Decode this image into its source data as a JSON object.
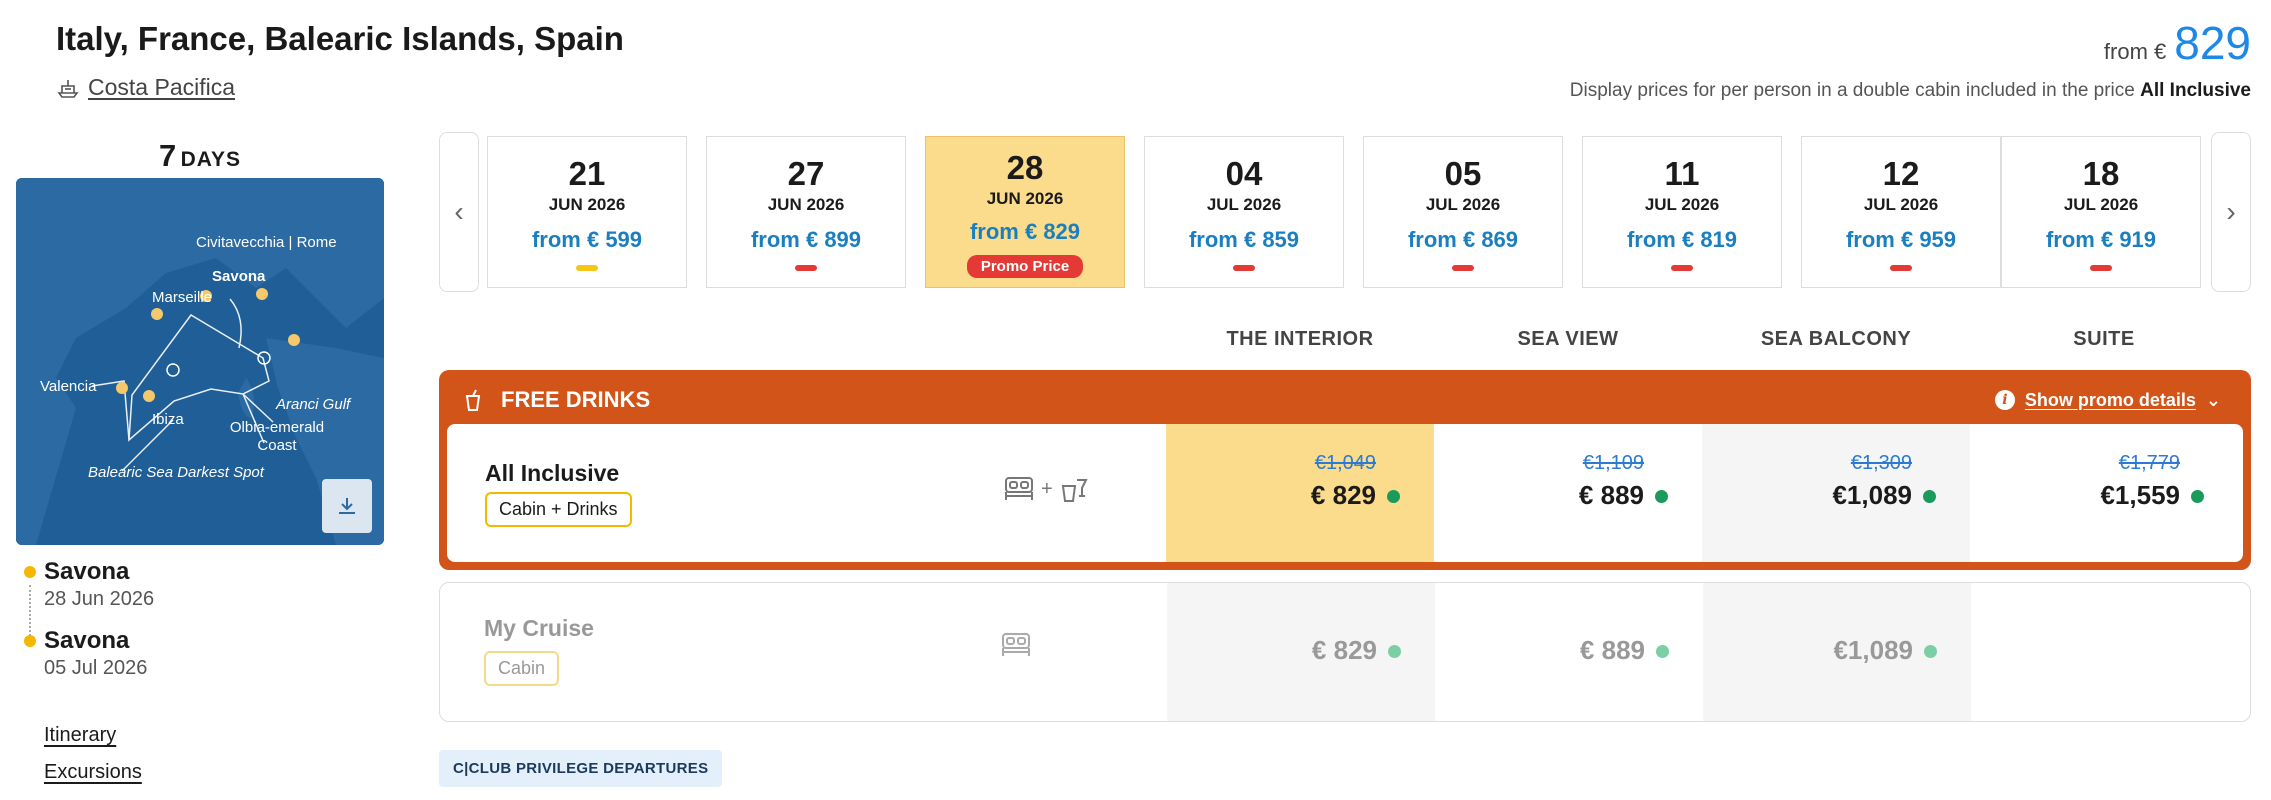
{
  "header": {
    "title": "Italy, France, Balearic Islands, Spain",
    "ship": "Costa Pacifica",
    "price_from_label": "from €",
    "price_from_value": "829",
    "price_note": "Display prices for per person in a double cabin included in the price",
    "price_note_bold": "All Inclusive"
  },
  "duration": {
    "number": "7",
    "unit": "DAYS"
  },
  "map": {
    "labels": {
      "civitavecchia": "Civitavecchia | Rome",
      "savona": "Savona",
      "marseille": "Marseille",
      "valencia": "Valencia",
      "ibiza": "Ibiza",
      "aranci": "Aranci Gulf",
      "olbia": "Olbia-emerald Coast",
      "balearic": "Balearic Sea Darkest Spot"
    }
  },
  "itinerary_summary": [
    {
      "city": "Savona",
      "date": "28 Jun 2026"
    },
    {
      "city": "Savona",
      "date": "05 Jul 2026"
    }
  ],
  "side_links": {
    "itinerary": "Itinerary",
    "excursions": "Excursions"
  },
  "dates": [
    {
      "day": "21",
      "month": "JUN 2026",
      "price": "from € 599",
      "indicator": "yellow"
    },
    {
      "day": "27",
      "month": "JUN 2026",
      "price": "from € 899",
      "indicator": "red"
    },
    {
      "day": "28",
      "month": "JUN 2026",
      "price": "from € 829",
      "badge": "Promo Price",
      "selected": true
    },
    {
      "day": "04",
      "month": "JUL 2026",
      "price": "from € 859",
      "indicator": "red"
    },
    {
      "day": "05",
      "month": "JUL 2026",
      "price": "from € 869",
      "indicator": "red"
    },
    {
      "day": "11",
      "month": "JUL 2026",
      "price": "from € 819",
      "indicator": "red"
    },
    {
      "day": "12",
      "month": "JUL 2026",
      "price": "from € 959",
      "indicator": "red"
    },
    {
      "day": "18",
      "month": "JUL 2026",
      "price": "from € 919",
      "indicator": "red"
    }
  ],
  "cabin_columns": [
    "THE INTERIOR",
    "SEA VIEW",
    "SEA BALCONY",
    "SUITE"
  ],
  "promo": {
    "title": "FREE DRINKS",
    "details_link": "Show promo details",
    "plan": {
      "name": "All Inclusive",
      "tag": "Cabin + Drinks",
      "plus": "+",
      "prices": [
        {
          "old": "€1,049",
          "now": "€ 829"
        },
        {
          "old": "€1,109",
          "now": "€ 889"
        },
        {
          "old": "€1,309",
          "now": "€1,089"
        },
        {
          "old": "€1,779",
          "now": "€1,559"
        }
      ]
    }
  },
  "my_cruise": {
    "name": "My Cruise",
    "tag": "Cabin",
    "prices": [
      "€ 829",
      "€ 889",
      "€1,089"
    ]
  },
  "club_badge": "C|CLUB PRIVILEGE DEPARTURES",
  "colors": {
    "accent": "#1e88e5",
    "promo": "#d35418",
    "selected": "#fbdb8c",
    "available": "#1a9b5c"
  }
}
